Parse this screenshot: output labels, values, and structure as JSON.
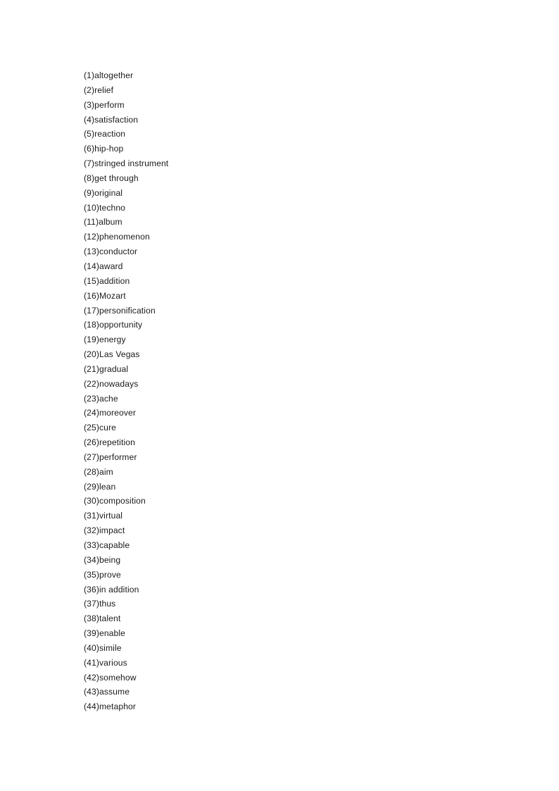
{
  "document": {
    "type": "vocabulary-word-list",
    "page_background": "#ffffff",
    "text_color": "#1a1a1a"
  },
  "word_list": {
    "items": [
      "(1)altogether",
      "(2)relief",
      "(3)perform",
      "(4)satisfaction",
      "(5)reaction",
      "(6)hip-hop",
      "(7)stringed instrument",
      "(8)get through",
      "(9)original",
      "(10)techno",
      "(11)album",
      "(12)phenomenon",
      "(13)conductor",
      "(14)award",
      "(15)addition",
      "(16)Mozart",
      "(17)personification",
      "(18)opportunity",
      "(19)energy",
      "(20)Las Vegas",
      "(21)gradual",
      "(22)nowadays",
      "(23)ache",
      "(24)moreover",
      "(25)cure",
      "(26)repetition",
      "(27)performer",
      "(28)aim",
      "(29)lean",
      "(30)composition",
      "(31)virtual",
      "(32)impact",
      "(33)capable",
      "(34)being",
      "(35)prove",
      "(36)in addition",
      "(37)thus",
      "(38)talent",
      "(39)enable",
      "(40)simile",
      "(41)various",
      "(42)somehow",
      "(43)assume",
      "(44)metaphor"
    ]
  }
}
